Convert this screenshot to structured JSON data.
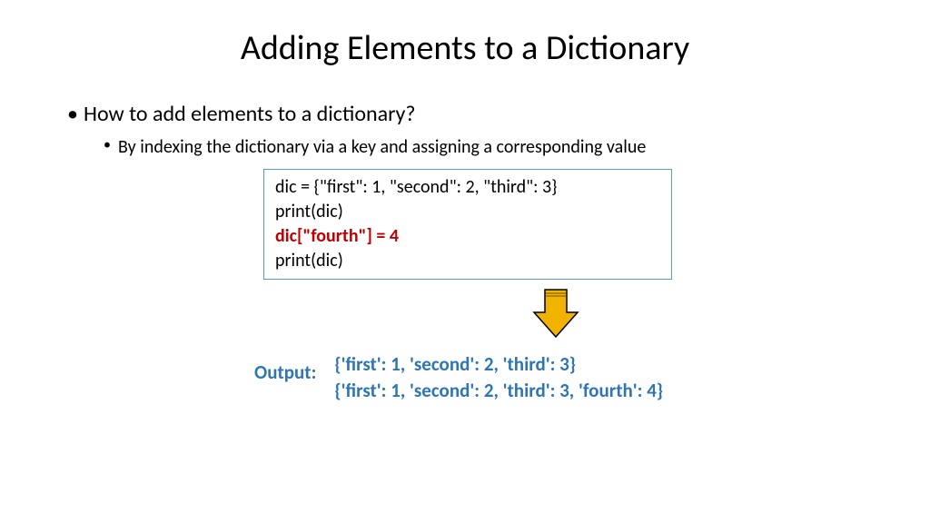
{
  "title": "Adding Elements to a Dictionary",
  "bullet1": "How to add elements to a dictionary?",
  "bullet2": "By indexing the dictionary via a key and assigning a corresponding value",
  "code": {
    "line1": "dic = {\"first\": 1, \"second\": 2, \"third\": 3}",
    "line2": "print(dic)",
    "line3": "dic[\"fourth\"] = 4",
    "line4": "print(dic)"
  },
  "output_label": "Output:",
  "output": {
    "line1": "{'first': 1, 'second': 2, 'third': 3}",
    "line2": "{'first': 1, 'second': 2, 'third': 3, 'fourth': 4}"
  },
  "colors": {
    "highlight": "#c00000",
    "accent": "#2e75b6",
    "border": "#5b9bd5",
    "arrow_fill": "#f2b200",
    "arrow_stroke": "#000000"
  }
}
